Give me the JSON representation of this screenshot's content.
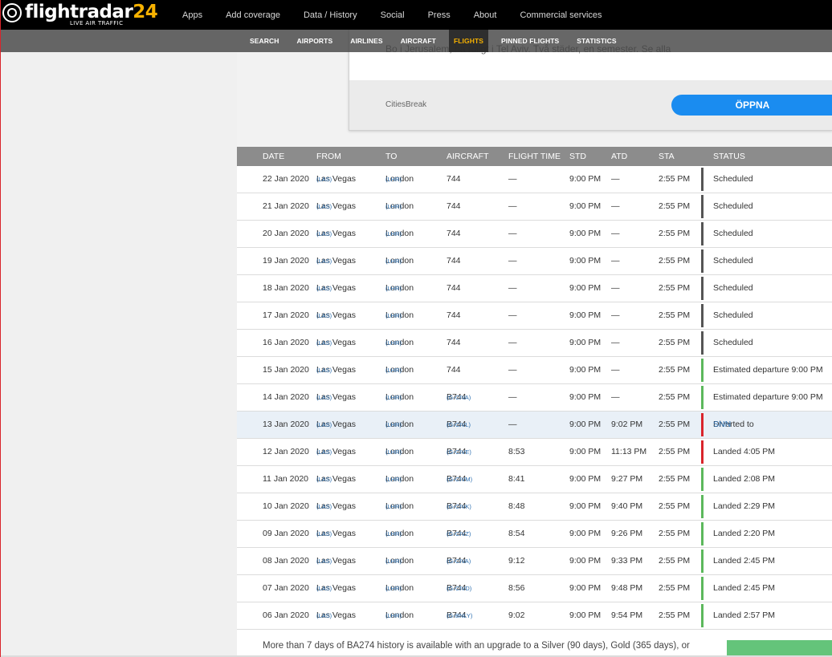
{
  "brand": {
    "name_prefix": "flightradar",
    "name_number": "24",
    "tagline": "LIVE AIR TRAFFIC"
  },
  "topnav": [
    "Apps",
    "Add coverage",
    "Data / History",
    "Social",
    "Press",
    "About",
    "Commercial services"
  ],
  "subnav": {
    "items": [
      "SEARCH",
      "AIRPORTS",
      "AIRLINES",
      "AIRCRAFT",
      "FLIGHTS",
      "PINNED FLIGHTS",
      "STATISTICS"
    ],
    "active": "FLIGHTS"
  },
  "ad": {
    "text": "Bo i Jerusalem, ha roligt i Tel Aviv. Två städer, en semester. Se alla",
    "brand": "CitiesBreak",
    "button": "ÖPPNA"
  },
  "colors": {
    "scheduled": "#555555",
    "estimated": "#5cb85c",
    "landed": "#5cb85c",
    "diverted": "#d9242b"
  },
  "table": {
    "headers": {
      "date": "DATE",
      "from": "FROM",
      "to": "TO",
      "aircraft": "AIRCRAFT",
      "flight_time": "FLIGHT TIME",
      "std": "STD",
      "atd": "ATD",
      "sta": "STA",
      "status": "STATUS"
    },
    "rows": [
      {
        "date": "22 Jan 2020",
        "from": "Las Vegas",
        "from_code": "(LAS)",
        "to": "London",
        "to_code": "(LHR)",
        "aircraft": "744",
        "reg": "",
        "flight_time": "—",
        "std": "9:00 PM",
        "atd": "—",
        "sta": "2:55 PM",
        "status": "Scheduled",
        "status_link": "",
        "bar": "scheduled"
      },
      {
        "date": "21 Jan 2020",
        "from": "Las Vegas",
        "from_code": "(LAS)",
        "to": "London",
        "to_code": "(LHR)",
        "aircraft": "744",
        "reg": "",
        "flight_time": "—",
        "std": "9:00 PM",
        "atd": "—",
        "sta": "2:55 PM",
        "status": "Scheduled",
        "status_link": "",
        "bar": "scheduled"
      },
      {
        "date": "20 Jan 2020",
        "from": "Las Vegas",
        "from_code": "(LAS)",
        "to": "London",
        "to_code": "(LHR)",
        "aircraft": "744",
        "reg": "",
        "flight_time": "—",
        "std": "9:00 PM",
        "atd": "—",
        "sta": "2:55 PM",
        "status": "Scheduled",
        "status_link": "",
        "bar": "scheduled"
      },
      {
        "date": "19 Jan 2020",
        "from": "Las Vegas",
        "from_code": "(LAS)",
        "to": "London",
        "to_code": "(LHR)",
        "aircraft": "744",
        "reg": "",
        "flight_time": "—",
        "std": "9:00 PM",
        "atd": "—",
        "sta": "2:55 PM",
        "status": "Scheduled",
        "status_link": "",
        "bar": "scheduled"
      },
      {
        "date": "18 Jan 2020",
        "from": "Las Vegas",
        "from_code": "(LAS)",
        "to": "London",
        "to_code": "(LHR)",
        "aircraft": "744",
        "reg": "",
        "flight_time": "—",
        "std": "9:00 PM",
        "atd": "—",
        "sta": "2:55 PM",
        "status": "Scheduled",
        "status_link": "",
        "bar": "scheduled"
      },
      {
        "date": "17 Jan 2020",
        "from": "Las Vegas",
        "from_code": "(LAS)",
        "to": "London",
        "to_code": "(LHR)",
        "aircraft": "744",
        "reg": "",
        "flight_time": "—",
        "std": "9:00 PM",
        "atd": "—",
        "sta": "2:55 PM",
        "status": "Scheduled",
        "status_link": "",
        "bar": "scheduled"
      },
      {
        "date": "16 Jan 2020",
        "from": "Las Vegas",
        "from_code": "(LAS)",
        "to": "London",
        "to_code": "(LHR)",
        "aircraft": "744",
        "reg": "",
        "flight_time": "—",
        "std": "9:00 PM",
        "atd": "—",
        "sta": "2:55 PM",
        "status": "Scheduled",
        "status_link": "",
        "bar": "scheduled"
      },
      {
        "date": "15 Jan 2020",
        "from": "Las Vegas",
        "from_code": "(LAS)",
        "to": "London",
        "to_code": "(LHR)",
        "aircraft": "744",
        "reg": "",
        "flight_time": "—",
        "std": "9:00 PM",
        "atd": "—",
        "sta": "2:55 PM",
        "status": "Estimated departure 9:00 PM",
        "status_link": "",
        "bar": "estimated"
      },
      {
        "date": "14 Jan 2020",
        "from": "Las Vegas",
        "from_code": "(LAS)",
        "to": "London",
        "to_code": "(LHR)",
        "aircraft": "B744",
        "reg": "(G-CIVA)",
        "flight_time": "—",
        "std": "9:00 PM",
        "atd": "—",
        "sta": "2:55 PM",
        "status": "Estimated departure 9:00 PM",
        "status_link": "",
        "bar": "estimated"
      },
      {
        "date": "13 Jan 2020",
        "from": "Las Vegas",
        "from_code": "(LAS)",
        "to": "London",
        "to_code": "(LHR)",
        "aircraft": "B744",
        "reg": "(G-CIVL)",
        "flight_time": "—",
        "std": "9:00 PM",
        "atd": "9:02 PM",
        "sta": "2:55 PM",
        "status": "Diverted to",
        "status_link": "SNN",
        "bar": "diverted",
        "highlight": true
      },
      {
        "date": "12 Jan 2020",
        "from": "Las Vegas",
        "from_code": "(LAS)",
        "to": "London",
        "to_code": "(LHR)",
        "aircraft": "B744",
        "reg": "(G-CIVE)",
        "flight_time": "8:53",
        "std": "9:00 PM",
        "atd": "11:13 PM",
        "sta": "2:55 PM",
        "status": "Landed 4:05 PM",
        "status_link": "",
        "bar": "diverted"
      },
      {
        "date": "11 Jan 2020",
        "from": "Las Vegas",
        "from_code": "(LAS)",
        "to": "London",
        "to_code": "(LHR)",
        "aircraft": "B744",
        "reg": "(G-CIVM)",
        "flight_time": "8:41",
        "std": "9:00 PM",
        "atd": "9:27 PM",
        "sta": "2:55 PM",
        "status": "Landed 2:08 PM",
        "status_link": "",
        "bar": "landed"
      },
      {
        "date": "10 Jan 2020",
        "from": "Las Vegas",
        "from_code": "(LAS)",
        "to": "London",
        "to_code": "(LHR)",
        "aircraft": "B744",
        "reg": "(G-CIVK)",
        "flight_time": "8:48",
        "std": "9:00 PM",
        "atd": "9:40 PM",
        "sta": "2:55 PM",
        "status": "Landed 2:29 PM",
        "status_link": "",
        "bar": "landed"
      },
      {
        "date": "09 Jan 2020",
        "from": "Las Vegas",
        "from_code": "(LAS)",
        "to": "London",
        "to_code": "(LHR)",
        "aircraft": "B744",
        "reg": "(G-CIVZ)",
        "flight_time": "8:54",
        "std": "9:00 PM",
        "atd": "9:26 PM",
        "sta": "2:55 PM",
        "status": "Landed 2:20 PM",
        "status_link": "",
        "bar": "landed"
      },
      {
        "date": "08 Jan 2020",
        "from": "Las Vegas",
        "from_code": "(LAS)",
        "to": "London",
        "to_code": "(LHR)",
        "aircraft": "B744",
        "reg": "(G-CIVA)",
        "flight_time": "9:12",
        "std": "9:00 PM",
        "atd": "9:33 PM",
        "sta": "2:55 PM",
        "status": "Landed 2:45 PM",
        "status_link": "",
        "bar": "landed"
      },
      {
        "date": "07 Jan 2020",
        "from": "Las Vegas",
        "from_code": "(LAS)",
        "to": "London",
        "to_code": "(LHR)",
        "aircraft": "B744",
        "reg": "(G-CIVD)",
        "flight_time": "8:56",
        "std": "9:00 PM",
        "atd": "9:48 PM",
        "sta": "2:55 PM",
        "status": "Landed 2:45 PM",
        "status_link": "",
        "bar": "landed"
      },
      {
        "date": "06 Jan 2020",
        "from": "Las Vegas",
        "from_code": "(LAS)",
        "to": "London",
        "to_code": "(LHR)",
        "aircraft": "B744",
        "reg": "(G-BNLY)",
        "flight_time": "9:02",
        "std": "9:00 PM",
        "atd": "9:54 PM",
        "sta": "2:55 PM",
        "status": "Landed 2:57 PM",
        "status_link": "",
        "bar": "landed"
      }
    ]
  },
  "footer": {
    "note": "More than 7 days of BA274 history is available with an upgrade to a Silver (90 days), Gold (365 days), or"
  }
}
